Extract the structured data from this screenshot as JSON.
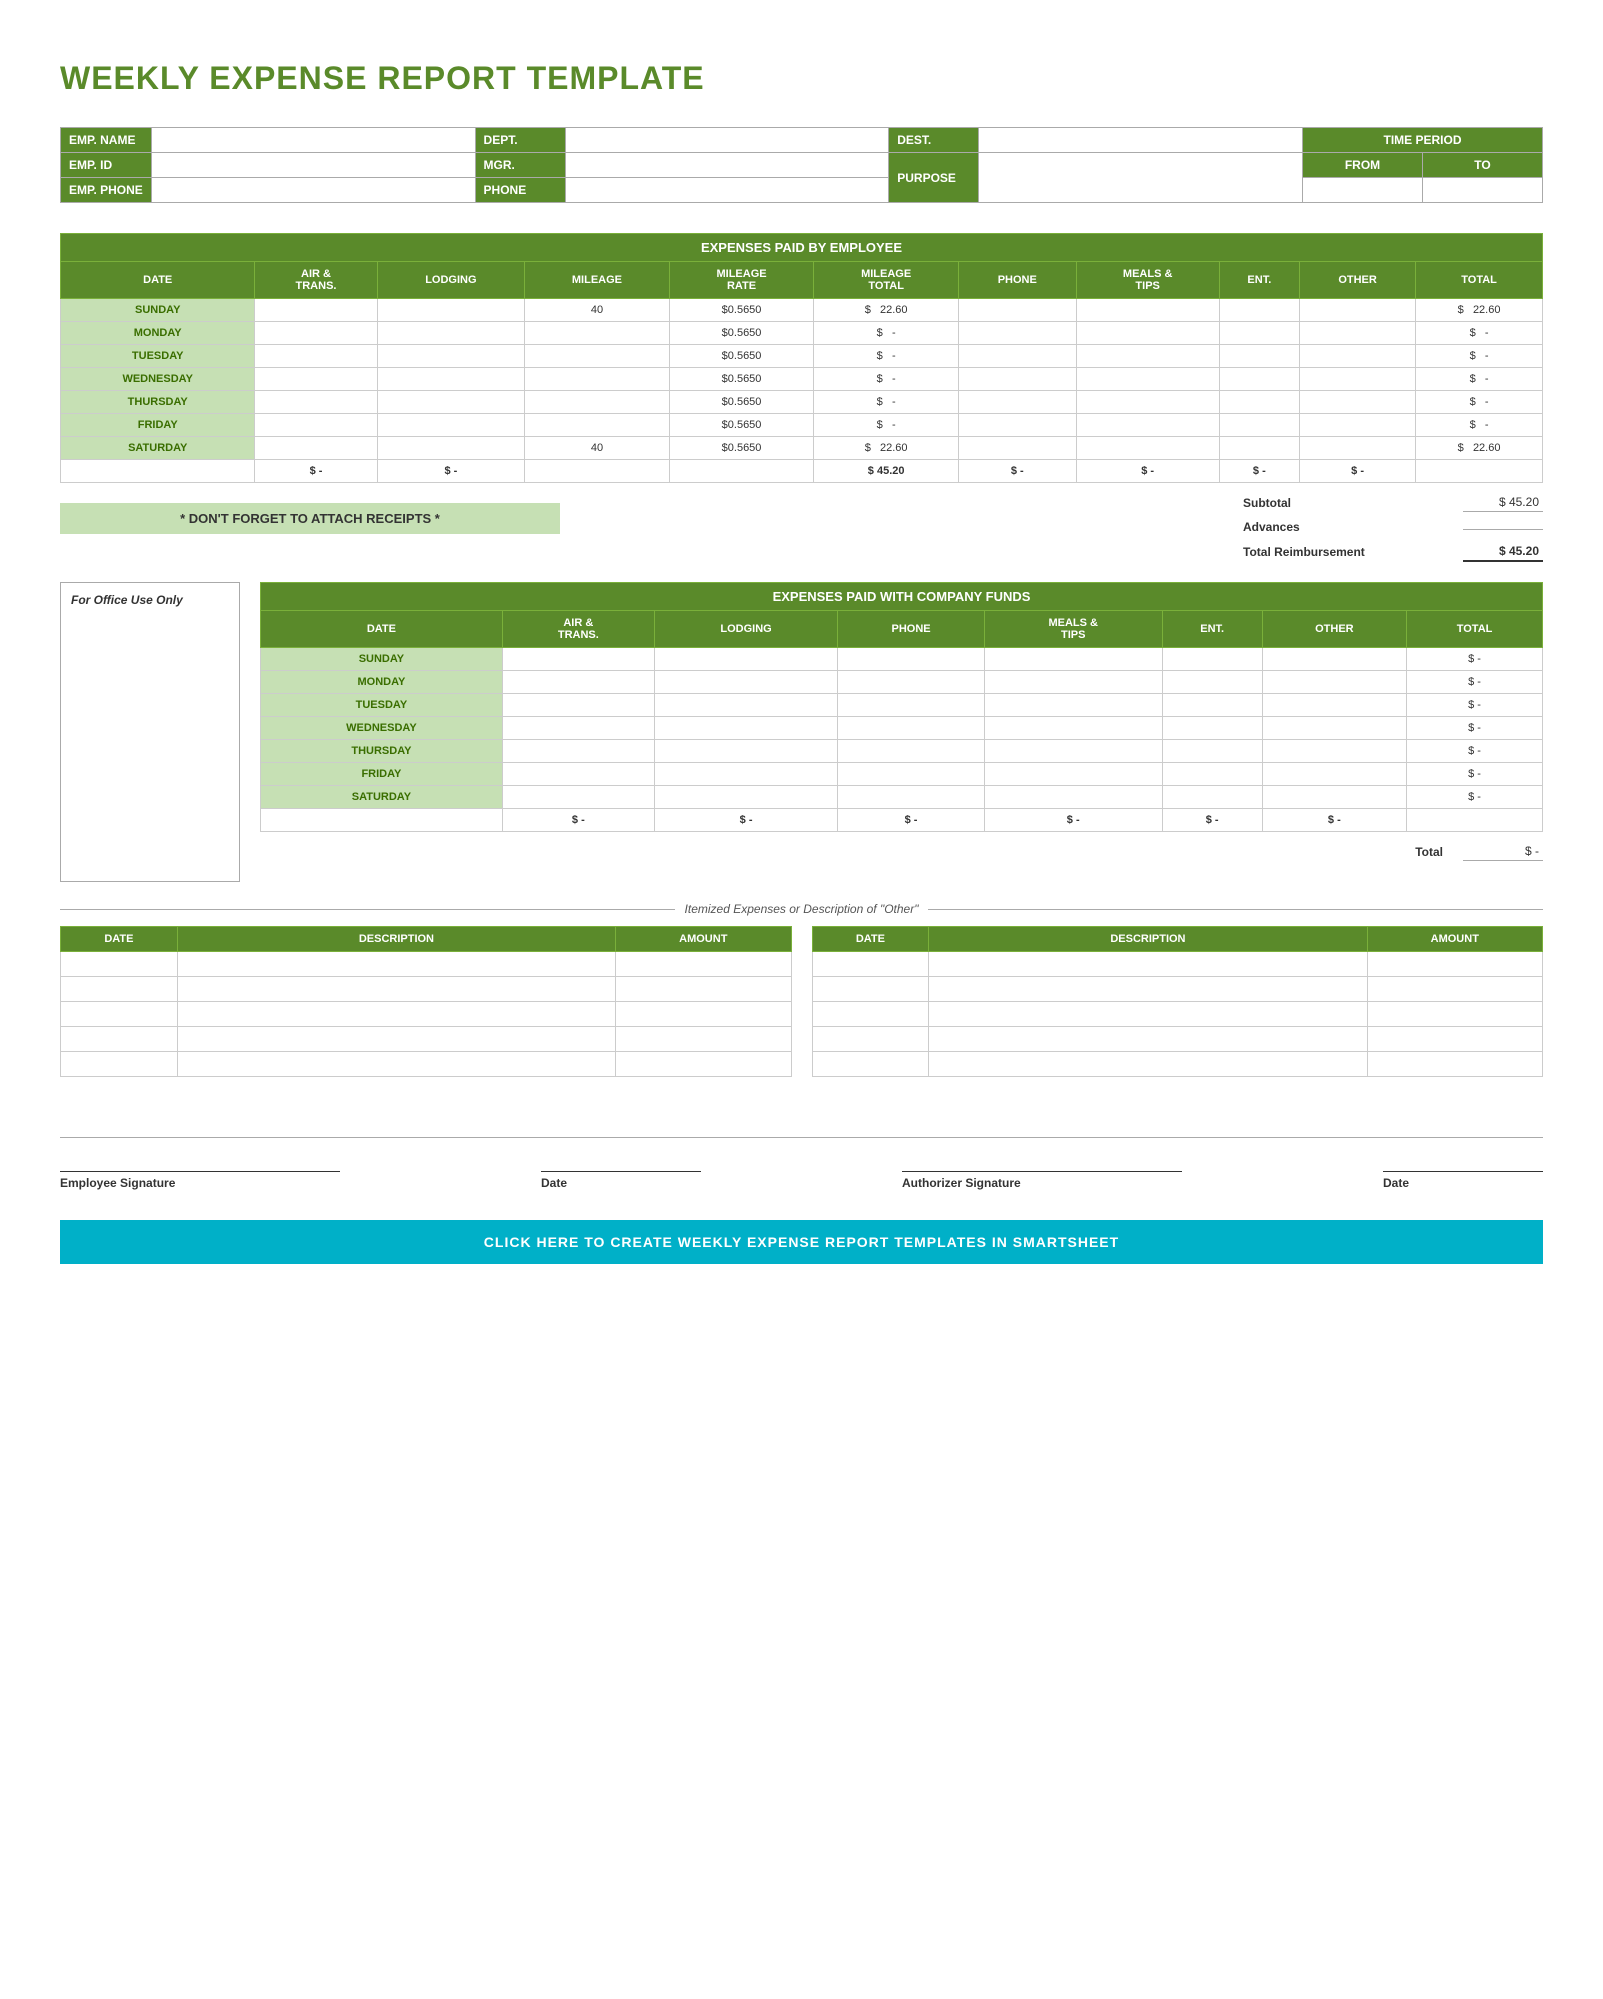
{
  "title": "WEEKLY EXPENSE REPORT TEMPLATE",
  "info": {
    "emp_name_label": "EMP. NAME",
    "dept_label": "DEPT.",
    "dest_label": "DEST.",
    "time_period_label": "TIME PERIOD",
    "emp_id_label": "EMP. ID",
    "mgr_label": "MGR.",
    "from_label": "FROM",
    "to_label": "TO",
    "emp_phone_label": "EMP. PHONE",
    "phone_label": "PHONE",
    "purpose_label": "PURPOSE"
  },
  "employee_section": {
    "header": "EXPENSES PAID BY EMPLOYEE",
    "columns": [
      "DATE",
      "AIR & TRANS.",
      "LODGING",
      "MILEAGE",
      "MILEAGE RATE",
      "MILEAGE TOTAL",
      "PHONE",
      "MEALS & TIPS",
      "ENT.",
      "OTHER",
      "TOTAL"
    ],
    "rows": [
      {
        "day": "SUNDAY",
        "air": "",
        "lodging": "",
        "mileage": "40",
        "rate": "$0.5650",
        "mil_total_prefix": "$",
        "mil_total": "22.60",
        "phone": "",
        "meals": "",
        "ent": "",
        "other": "",
        "total_prefix": "$",
        "total": "22.60"
      },
      {
        "day": "MONDAY",
        "air": "",
        "lodging": "",
        "mileage": "",
        "rate": "$0.5650",
        "mil_total_prefix": "$",
        "mil_total": "-",
        "phone": "",
        "meals": "",
        "ent": "",
        "other": "",
        "total_prefix": "$",
        "total": "-"
      },
      {
        "day": "TUESDAY",
        "air": "",
        "lodging": "",
        "mileage": "",
        "rate": "$0.5650",
        "mil_total_prefix": "$",
        "mil_total": "-",
        "phone": "",
        "meals": "",
        "ent": "",
        "other": "",
        "total_prefix": "$",
        "total": "-"
      },
      {
        "day": "WEDNESDAY",
        "air": "",
        "lodging": "",
        "mileage": "",
        "rate": "$0.5650",
        "mil_total_prefix": "$",
        "mil_total": "-",
        "phone": "",
        "meals": "",
        "ent": "",
        "other": "",
        "total_prefix": "$",
        "total": "-"
      },
      {
        "day": "THURSDAY",
        "air": "",
        "lodging": "",
        "mileage": "",
        "rate": "$0.5650",
        "mil_total_prefix": "$",
        "mil_total": "-",
        "phone": "",
        "meals": "",
        "ent": "",
        "other": "",
        "total_prefix": "$",
        "total": "-"
      },
      {
        "day": "FRIDAY",
        "air": "",
        "lodging": "",
        "mileage": "",
        "rate": "$0.5650",
        "mil_total_prefix": "$",
        "mil_total": "-",
        "phone": "",
        "meals": "",
        "ent": "",
        "other": "",
        "total_prefix": "$",
        "total": "-"
      },
      {
        "day": "SATURDAY",
        "air": "",
        "lodging": "",
        "mileage": "40",
        "rate": "$0.5650",
        "mil_total_prefix": "$",
        "mil_total": "22.60",
        "phone": "",
        "meals": "",
        "ent": "",
        "other": "",
        "total_prefix": "$",
        "total": "22.60"
      }
    ],
    "totals_row": {
      "air_prefix": "$",
      "air": "-",
      "lodging_prefix": "$",
      "lodging": "-",
      "mil_total_prefix": "$",
      "mil_total": "45.20",
      "phone_prefix": "$",
      "phone": "-",
      "meals_prefix": "$",
      "meals": "-",
      "ent_prefix": "$",
      "ent": "-",
      "other_prefix": "$",
      "other": "-"
    },
    "subtotal_label": "Subtotal",
    "subtotal_prefix": "$",
    "subtotal_value": "45.20",
    "advances_label": "Advances",
    "total_reimbursement_label": "Total Reimbursement",
    "total_reimbursement_prefix": "$",
    "total_reimbursement_value": "45.20",
    "dont_forget": "* DON'T FORGET TO ATTACH RECEIPTS *"
  },
  "company_section": {
    "office_use_label": "For Office Use Only",
    "header": "EXPENSES PAID WITH COMPANY FUNDS",
    "columns": [
      "DATE",
      "AIR & TRANS.",
      "LODGING",
      "PHONE",
      "MEALS & TIPS",
      "ENT.",
      "OTHER",
      "TOTAL"
    ],
    "rows": [
      {
        "day": "SUNDAY",
        "air": "",
        "lodging": "",
        "phone": "",
        "meals": "",
        "ent": "",
        "other": "",
        "total_prefix": "$",
        "total": "-"
      },
      {
        "day": "MONDAY",
        "air": "",
        "lodging": "",
        "phone": "",
        "meals": "",
        "ent": "",
        "other": "",
        "total_prefix": "$",
        "total": "-"
      },
      {
        "day": "TUESDAY",
        "air": "",
        "lodging": "",
        "phone": "",
        "meals": "",
        "ent": "",
        "other": "",
        "total_prefix": "$",
        "total": "-"
      },
      {
        "day": "WEDNESDAY",
        "air": "",
        "lodging": "",
        "phone": "",
        "meals": "",
        "ent": "",
        "other": "",
        "total_prefix": "$",
        "total": "-"
      },
      {
        "day": "THURSDAY",
        "air": "",
        "lodging": "",
        "phone": "",
        "meals": "",
        "ent": "",
        "other": "",
        "total_prefix": "$",
        "total": "-"
      },
      {
        "day": "FRIDAY",
        "air": "",
        "lodging": "",
        "phone": "",
        "meals": "",
        "ent": "",
        "other": "",
        "total_prefix": "$",
        "total": "-"
      },
      {
        "day": "SATURDAY",
        "air": "",
        "lodging": "",
        "phone": "",
        "meals": "",
        "ent": "",
        "other": "",
        "total_prefix": "$",
        "total": "-"
      }
    ],
    "totals_row": {
      "air_prefix": "$",
      "air": "-",
      "lodging_prefix": "$",
      "lodging": "-",
      "phone_prefix": "$",
      "phone": "-",
      "meals_prefix": "$",
      "meals": "-",
      "ent_prefix": "$",
      "ent": "-",
      "other_prefix": "$",
      "other": "-"
    },
    "total_label": "Total",
    "total_prefix": "$",
    "total_value": "-"
  },
  "itemized": {
    "divider_text": "Itemized Expenses or Description of \"Other\"",
    "left_columns": [
      "DATE",
      "DESCRIPTION",
      "AMOUNT"
    ],
    "right_columns": [
      "DATE",
      "DESCRIPTION",
      "AMOUNT"
    ],
    "left_rows": [
      {
        "date": "",
        "description": "",
        "amount": ""
      },
      {
        "date": "",
        "description": "",
        "amount": ""
      },
      {
        "date": "",
        "description": "",
        "amount": ""
      },
      {
        "date": "",
        "description": "",
        "amount": ""
      },
      {
        "date": "",
        "description": "",
        "amount": ""
      }
    ],
    "right_rows": [
      {
        "date": "",
        "description": "",
        "amount": ""
      },
      {
        "date": "",
        "description": "",
        "amount": ""
      },
      {
        "date": "",
        "description": "",
        "amount": ""
      },
      {
        "date": "",
        "description": "",
        "amount": ""
      },
      {
        "date": "",
        "description": "",
        "amount": ""
      }
    ]
  },
  "signatures": {
    "employee_label": "Employee Signature",
    "date1_label": "Date",
    "authorizer_label": "Authorizer Signature",
    "date2_label": "Date"
  },
  "cta": {
    "label": "CLICK HERE TO CREATE WEEKLY EXPENSE REPORT TEMPLATES IN SMARTSHEET"
  }
}
